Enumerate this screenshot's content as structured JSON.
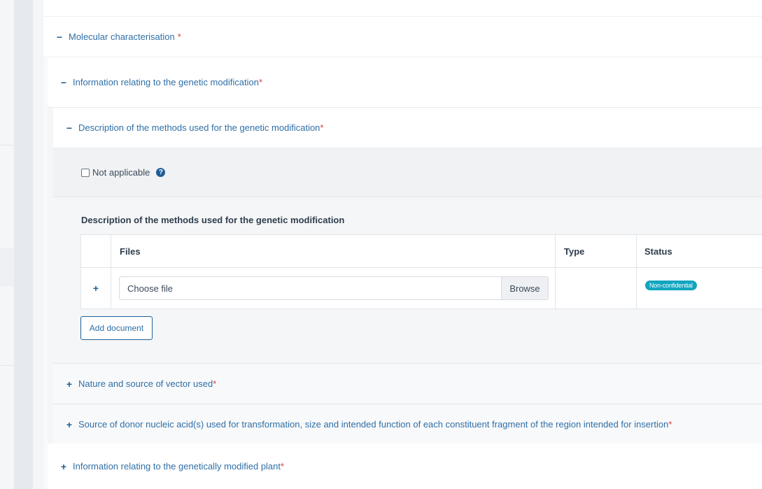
{
  "sections": {
    "molecular": {
      "toggle": "−",
      "label": "Molecular characterisation",
      "required_mark": "*"
    },
    "genetic_mod": {
      "toggle": "−",
      "label": "Information relating to the genetic modification",
      "required_mark": "*"
    },
    "methods": {
      "toggle": "−",
      "label": "Description of the methods used for the genetic modification",
      "required_mark": "*"
    },
    "vector": {
      "toggle": "+",
      "label": "Nature and source of vector used",
      "required_mark": "*"
    },
    "donor": {
      "toggle": "+",
      "label": "Source of donor nucleic acid(s) used for transformation, size and intended function of each constituent fragment of the region intended for insertion",
      "required_mark": "*"
    },
    "gm_plant": {
      "toggle": "+",
      "label": "Information relating to the genetically modified plant",
      "required_mark": "*"
    }
  },
  "not_applicable": {
    "label": "Not applicable",
    "checked": false,
    "help_icon": "question-circle-icon",
    "help_glyph": "?"
  },
  "documents": {
    "title": "Description of the methods used for the genetic modification",
    "columns": {
      "files": "Files",
      "type": "Type",
      "status": "Status"
    },
    "rows": [
      {
        "add_glyph": "+",
        "file_placeholder": "Choose file",
        "browse_label": "Browse",
        "type": "",
        "status": "Non-confidential"
      }
    ],
    "add_button": "Add document"
  },
  "colors": {
    "link": "#2f6fa6",
    "required": "#e03b3b",
    "badge": "#11a5bf",
    "accent": "#1f5f96"
  }
}
